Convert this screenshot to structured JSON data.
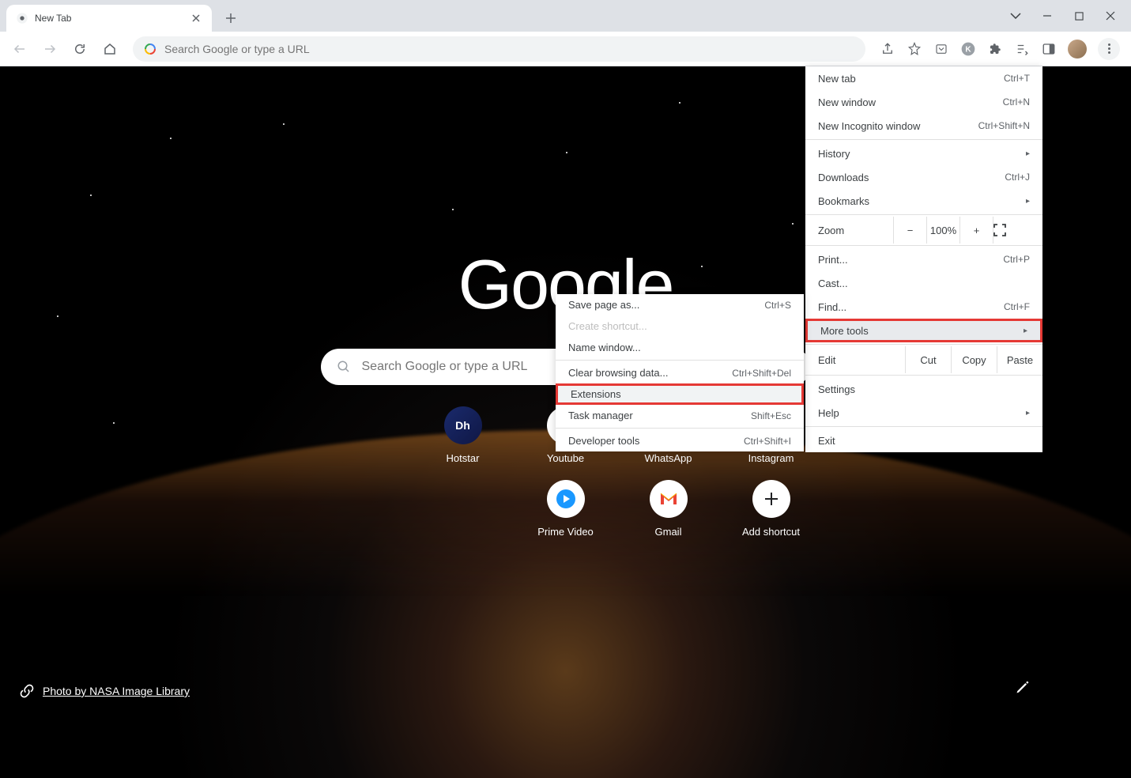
{
  "tab": {
    "title": "New Tab"
  },
  "omnibox": {
    "placeholder": "Search Google or type a URL"
  },
  "logo": "Google",
  "searchbox": {
    "placeholder": "Search Google or type a URL"
  },
  "shortcuts": {
    "row1": [
      {
        "label": "Hotstar"
      },
      {
        "label": "Youtube"
      },
      {
        "label": "WhatsApp"
      },
      {
        "label": "Instagram"
      }
    ],
    "row2": [
      {
        "label": "Prime Video"
      },
      {
        "label": "Gmail"
      },
      {
        "label": "Add shortcut"
      }
    ]
  },
  "attribution": {
    "text": "Photo by NASA Image Library"
  },
  "menu": {
    "new_tab": {
      "label": "New tab",
      "key": "Ctrl+T"
    },
    "new_window": {
      "label": "New window",
      "key": "Ctrl+N"
    },
    "new_incognito": {
      "label": "New Incognito window",
      "key": "Ctrl+Shift+N"
    },
    "history": {
      "label": "History"
    },
    "downloads": {
      "label": "Downloads",
      "key": "Ctrl+J"
    },
    "bookmarks": {
      "label": "Bookmarks"
    },
    "zoom": {
      "label": "Zoom",
      "value": "100%"
    },
    "print": {
      "label": "Print...",
      "key": "Ctrl+P"
    },
    "cast": {
      "label": "Cast..."
    },
    "find": {
      "label": "Find...",
      "key": "Ctrl+F"
    },
    "more_tools": {
      "label": "More tools"
    },
    "edit": {
      "label": "Edit",
      "cut": "Cut",
      "copy": "Copy",
      "paste": "Paste"
    },
    "settings": {
      "label": "Settings"
    },
    "help": {
      "label": "Help"
    },
    "exit": {
      "label": "Exit"
    }
  },
  "submenu": {
    "save_page": {
      "label": "Save page as...",
      "key": "Ctrl+S"
    },
    "create_shortcut": {
      "label": "Create shortcut..."
    },
    "name_window": {
      "label": "Name window..."
    },
    "clear_data": {
      "label": "Clear browsing data...",
      "key": "Ctrl+Shift+Del"
    },
    "extensions": {
      "label": "Extensions"
    },
    "task_manager": {
      "label": "Task manager",
      "key": "Shift+Esc"
    },
    "dev_tools": {
      "label": "Developer tools",
      "key": "Ctrl+Shift+I"
    }
  }
}
